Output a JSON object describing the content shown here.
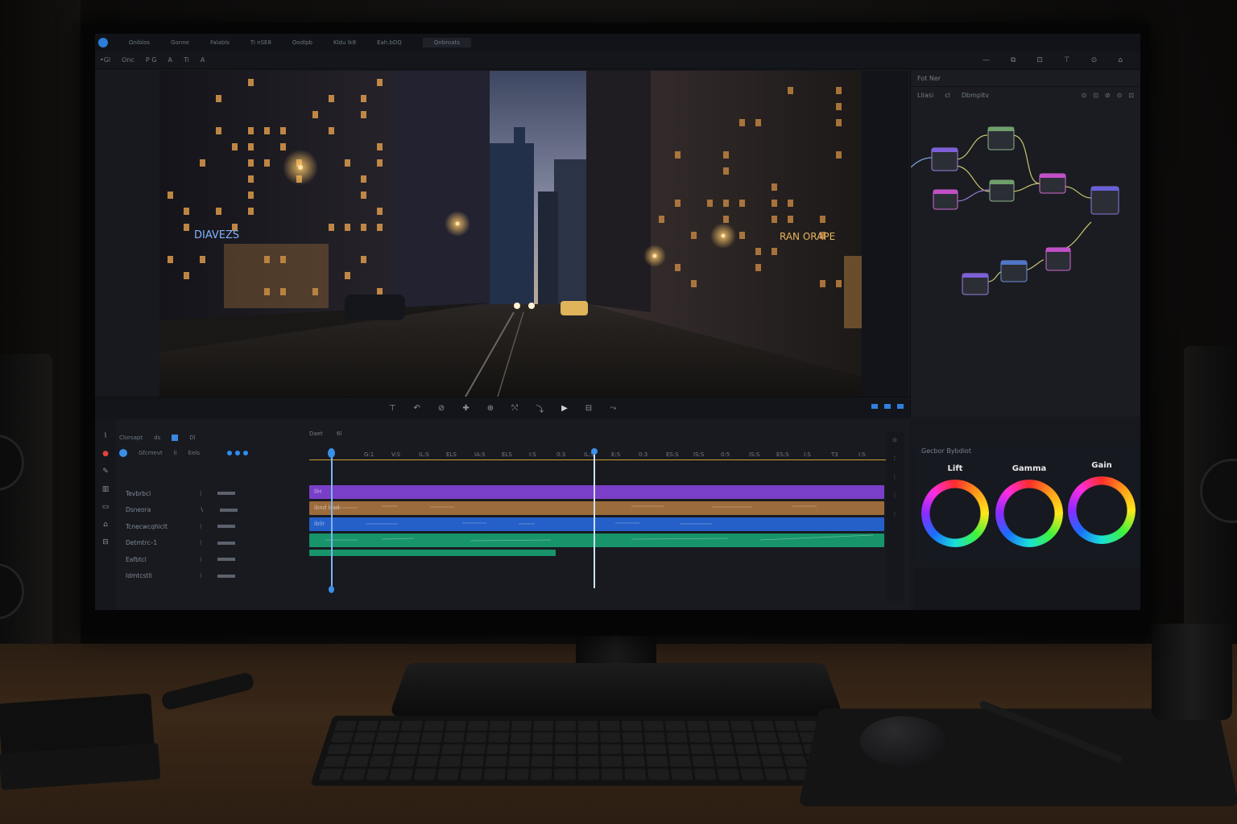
{
  "window": {
    "title": ""
  },
  "menubar": {
    "items": [
      "Ωniblos",
      "Gonne",
      "Falabls",
      "Ti nSE8",
      "Oodlpb",
      "Kldu lk8",
      "Eah.bDQ",
      "Qnbroats"
    ]
  },
  "toolbar": {
    "items": [
      "•Gl",
      "Onc",
      "P G",
      "A",
      "Ti",
      "A"
    ],
    "right_items": [
      "—",
      "⧉",
      "⊡",
      "⊤",
      "⊙",
      "⌂"
    ]
  },
  "viewer": {
    "storefront_sign": "DIAVEZS",
    "right_sign": "RAN ORAPE"
  },
  "node_panel": {
    "header": [
      "Fot Ner"
    ],
    "subheader": [
      "Lliasi",
      "cl",
      "Dbmpltv"
    ],
    "icons": [
      "⊙",
      "⊡",
      "⊘",
      "⊙",
      "⊡"
    ]
  },
  "transport": {
    "tools": [
      "⊤",
      "↶",
      "⊘",
      "✚",
      "⊕",
      "⤲",
      "⤵",
      "▶",
      "⊟",
      "⤳"
    ],
    "right": [
      "",
      "",
      ""
    ]
  },
  "timeline": {
    "header_row1": [
      "Clorsapt",
      "ds",
      "Dl"
    ],
    "header_row2": [
      "Gfcmevt",
      "li",
      "Eels"
    ],
    "ruler_labels": [
      "Daet",
      "6l",
      "G:1",
      "V:S",
      "IL:S",
      "ELS",
      "IA:S",
      "ELS",
      "I:S",
      "0:3",
      "IL:S",
      "E:S",
      "0:3",
      "ES:S",
      "IS:S",
      "0:5",
      "IS:S",
      "ES:S",
      "I:S",
      "T3",
      "I:S"
    ],
    "tracks": [
      {
        "name": "Tevbrbcl",
        "flag": "⁝"
      },
      {
        "name": "Dsneora",
        "flag": "∖"
      },
      {
        "name": "Tcnecwcqhiclt",
        "flag": "⁝"
      },
      {
        "name": "Detmtrc–1",
        "flag": "⁝"
      },
      {
        "name": "Eafbtcl",
        "flag": "⁝"
      },
      {
        "name": "Idmtcstll",
        "flag": "⁝"
      }
    ],
    "clips": [
      {
        "track": 0,
        "label": "llH",
        "color": "#7a3fc8"
      },
      {
        "track": 1,
        "label": "ibnd lcsd",
        "color": "#9c6b3c"
      },
      {
        "track": 2,
        "label": "iblir",
        "color": "#2560c9"
      },
      {
        "track": 3,
        "label": "",
        "color": "#17946a"
      },
      {
        "track": 4,
        "label": "",
        "color": "#17946a"
      },
      {
        "track": 5,
        "label": "",
        "color": "#17946a"
      }
    ]
  },
  "color_wheels": {
    "header": "Gecbor  Bybdiot",
    "wheels": [
      "Lift",
      "Gamma",
      "Gain"
    ]
  }
}
